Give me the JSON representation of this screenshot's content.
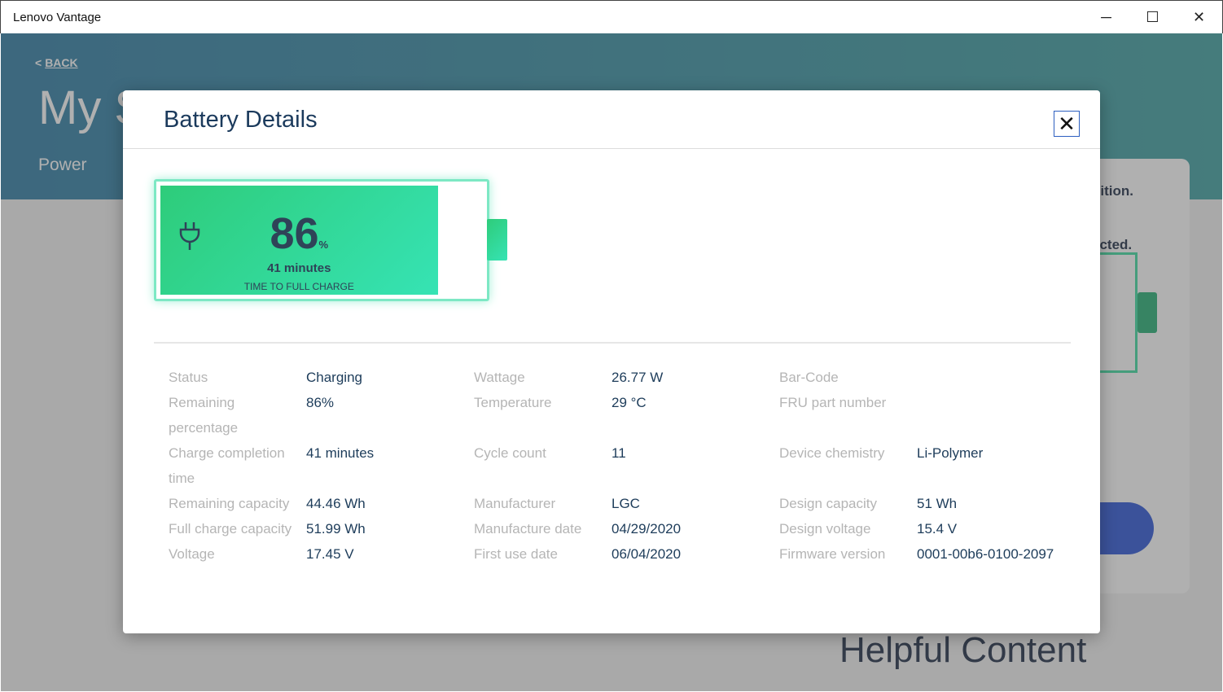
{
  "window": {
    "title": "Lenovo Vantage",
    "minimize": "─",
    "maximize": "☐",
    "close": "✕"
  },
  "background": {
    "back": "BACK",
    "back_chevron": "<",
    "title": "My S",
    "subtitle": "Power",
    "card_text_1": "dition.",
    "card_text_2": "ected.",
    "helpful": "Helpful Content"
  },
  "dialog": {
    "title": "Battery Details",
    "close": "✕",
    "battery": {
      "percent": "86",
      "percent_value": 86,
      "percent_sign": "%",
      "time": "41 minutes",
      "time_label": "TIME TO FULL CHARGE"
    },
    "rows": [
      [
        {
          "label": "Status",
          "value": "Charging"
        },
        {
          "label": "Wattage",
          "value": "26.77 W"
        },
        {
          "label": "Bar-Code",
          "value": ""
        }
      ],
      [
        {
          "label": "Remaining percentage",
          "value": "86%"
        },
        {
          "label": "Temperature",
          "value": "29 °C"
        },
        {
          "label": "FRU part number",
          "value": ""
        }
      ],
      [
        {
          "label": "Charge completion time",
          "value": "41 minutes"
        },
        {
          "label": "Cycle count",
          "value": "11"
        },
        {
          "label": "Device chemistry",
          "value": "Li-Polymer"
        }
      ],
      [
        {
          "label": "Remaining capacity",
          "value": "44.46 Wh"
        },
        {
          "label": "Manufacturer",
          "value": "LGC"
        },
        {
          "label": "Design capacity",
          "value": "51 Wh"
        }
      ],
      [
        {
          "label": "Full charge capacity",
          "value": "51.99 Wh"
        },
        {
          "label": "Manufacture date",
          "value": "04/29/2020"
        },
        {
          "label": "Design voltage",
          "value": "15.4 V"
        }
      ],
      [
        {
          "label": "Voltage",
          "value": "17.45 V"
        },
        {
          "label": "First use date",
          "value": "06/04/2020"
        },
        {
          "label": "Firmware version",
          "value": "0001-00b6-0100-2097"
        }
      ]
    ]
  }
}
